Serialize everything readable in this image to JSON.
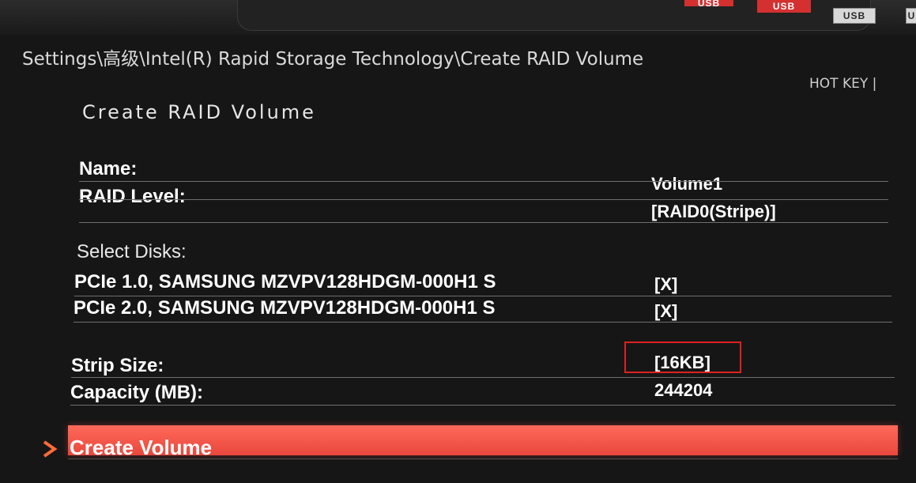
{
  "top_ports": [
    {
      "label": "USB"
    },
    {
      "label": "USB"
    },
    {
      "label": "USB"
    },
    {
      "label": "U"
    }
  ],
  "breadcrumb": "Settings\\高级\\Intel(R) Rapid Storage Technology\\Create RAID Volume",
  "hotkey": "HOT KEY  |",
  "page_title": "Create RAID Volume",
  "fields": {
    "name_label": "Name:",
    "name_value": "Volume1",
    "raid_level_label": "RAID Level:",
    "raid_level_value": "[RAID0(Stripe)]",
    "select_disks_label": "Select Disks:",
    "disks": [
      {
        "label": "PCIe 1.0, SAMSUNG MZVPV128HDGM-000H1 S",
        "value": "[X]"
      },
      {
        "label": "PCIe 2.0, SAMSUNG MZVPV128HDGM-000H1 S",
        "value": "[X]"
      }
    ],
    "strip_size_label": "Strip Size:",
    "strip_size_value": "[16KB]",
    "capacity_label": "Capacity (MB):",
    "capacity_value": "244204"
  },
  "action": {
    "create_volume_label": "Create Volume"
  },
  "colors": {
    "background": "#161616",
    "accent": "#e9473d",
    "highlight_box": "#e02020"
  },
  "icons": {
    "selection_marker": "chevron-right-icon"
  }
}
